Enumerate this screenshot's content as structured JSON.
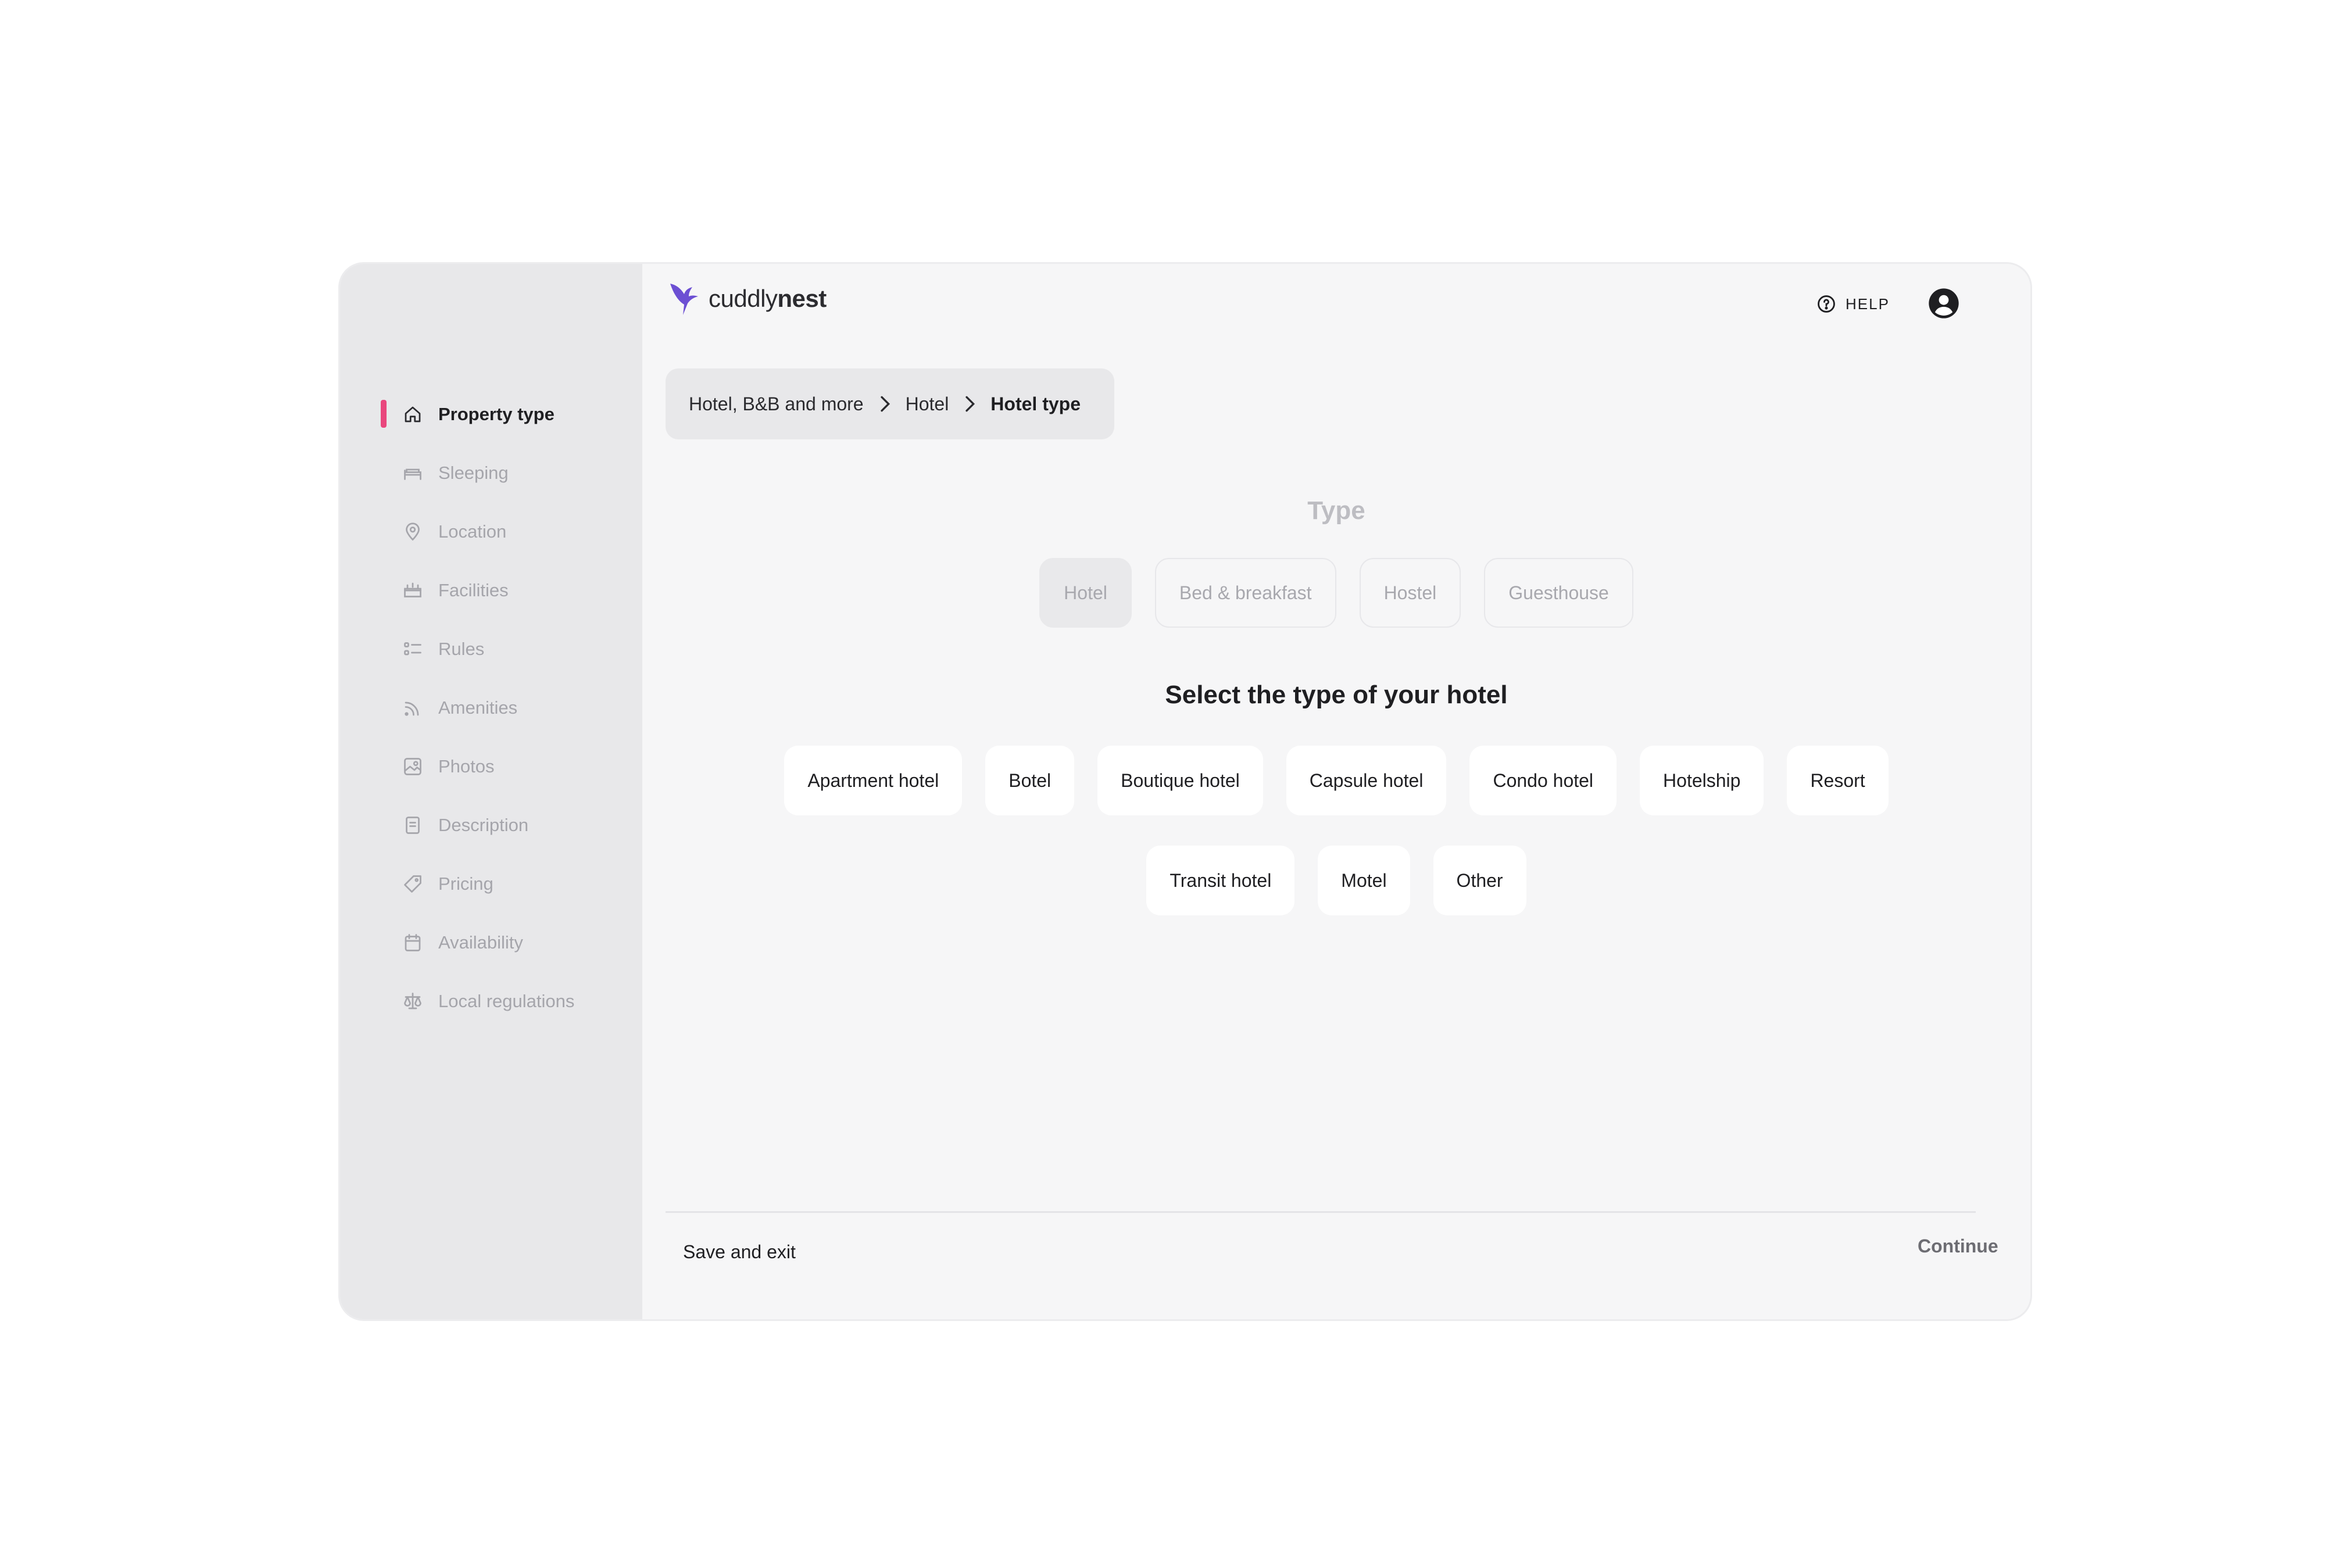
{
  "brand": {
    "name_light": "cuddly",
    "name_bold": "nest",
    "accent_color": "#6c4fd3"
  },
  "header": {
    "help_label": "HELP",
    "help_icon": "question-circle-icon",
    "account_icon": "user-circle-icon"
  },
  "sidebar": {
    "active_marker_color": "#e9477d",
    "items": [
      {
        "label": "Property type",
        "icon": "home-icon",
        "active": true
      },
      {
        "label": "Sleeping",
        "icon": "bed-icon",
        "active": false
      },
      {
        "label": "Location",
        "icon": "map-pin-icon",
        "active": false
      },
      {
        "label": "Facilities",
        "icon": "facilities-icon",
        "active": false
      },
      {
        "label": "Rules",
        "icon": "rules-list-icon",
        "active": false
      },
      {
        "label": "Amenities",
        "icon": "wifi-icon",
        "active": false
      },
      {
        "label": "Photos",
        "icon": "photo-icon",
        "active": false
      },
      {
        "label": "Description",
        "icon": "document-icon",
        "active": false
      },
      {
        "label": "Pricing",
        "icon": "price-tag-icon",
        "active": false
      },
      {
        "label": "Availability",
        "icon": "calendar-icon",
        "active": false
      },
      {
        "label": "Local regulations",
        "icon": "scale-icon",
        "active": false
      }
    ]
  },
  "breadcrumb": {
    "items": [
      "Hotel, B&B and more",
      "Hotel",
      "Hotel type"
    ]
  },
  "type_section": {
    "title": "Type",
    "options": [
      "Hotel",
      "Bed & breakfast",
      "Hostel",
      "Guesthouse"
    ],
    "selected": "Hotel"
  },
  "hotel_section": {
    "title": "Select the type of your hotel",
    "row1": [
      "Apartment hotel",
      "Botel",
      "Boutique hotel",
      "Capsule hotel",
      "Condo hotel",
      "Hotelship",
      "Resort"
    ],
    "row2": [
      "Transit hotel",
      "Motel",
      "Other"
    ]
  },
  "footer": {
    "save_label": "Save and exit",
    "continue_label": "Continue"
  }
}
